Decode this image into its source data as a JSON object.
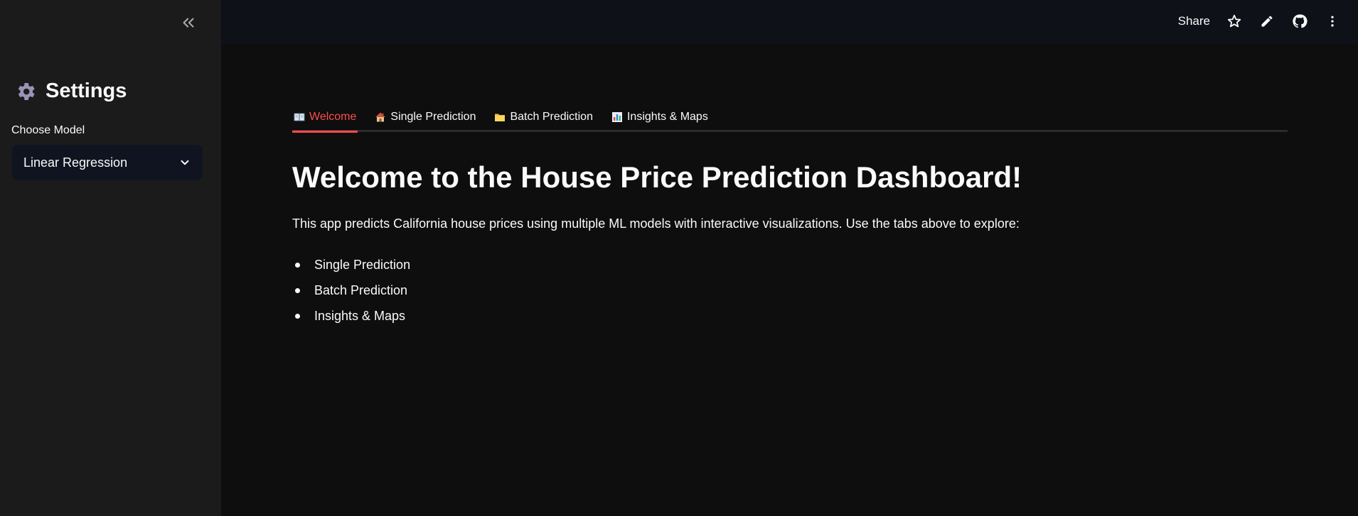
{
  "sidebar": {
    "title": "Settings",
    "model_label": "Choose Model",
    "model_value": "Linear Regression"
  },
  "header": {
    "share_label": "Share"
  },
  "tabs": [
    {
      "label": "Welcome",
      "icon": "open-book-icon",
      "active": true
    },
    {
      "label": "Single Prediction",
      "icon": "house-icon",
      "active": false
    },
    {
      "label": "Batch Prediction",
      "icon": "folder-icon",
      "active": false
    },
    {
      "label": "Insights & Maps",
      "icon": "bar-chart-icon",
      "active": false
    }
  ],
  "main": {
    "title": "Welcome to the House Price Prediction Dashboard!",
    "intro": "This app predicts California house prices using multiple ML models with interactive visualizations. Use the tabs above to explore:",
    "features": [
      "Single Prediction",
      "Batch Prediction",
      "Insights & Maps"
    ]
  },
  "colors": {
    "accent": "#ff4b4b",
    "sidebar_bg": "#1b1b1b",
    "main_bg": "#0e0e0e"
  }
}
